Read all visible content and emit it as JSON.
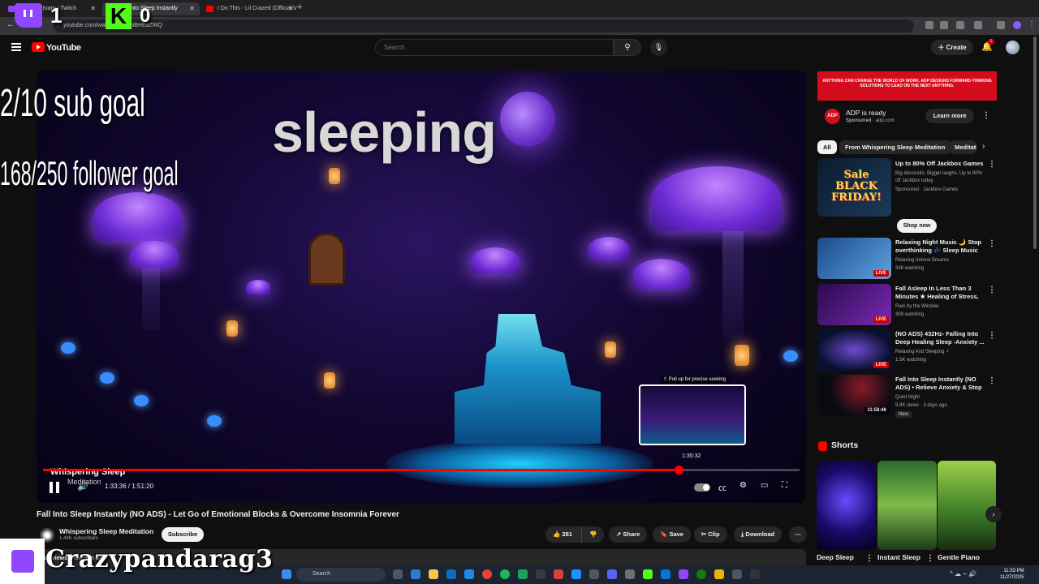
{
  "browser": {
    "tabs": [
      {
        "label": "voyager_tuary - Twitch",
        "color": "#9146ff",
        "active": false
      },
      {
        "label": "Fall Into Sleep Instantly",
        "color": "#ff0000",
        "active": true
      },
      {
        "label": "I Do This - Lil Crazed (Official V",
        "color": "#ff0000",
        "active": false
      }
    ],
    "url": "youtube.com/watch?v=MBNBHEaZWQ"
  },
  "header": {
    "logo_text": "YouTube",
    "search_placeholder": "Search",
    "create_label": "Create",
    "notif_count": "1"
  },
  "player": {
    "overlay_word": "sleeping",
    "seek_hint": "Pull up for precise seeking",
    "seek_time": "1:35:32",
    "time_label": "1:33:36 / 1:51:20",
    "progress_fraction": 0.84,
    "watermark_line1": "Whispering Sleep",
    "watermark_line2": "Meditation"
  },
  "video": {
    "title": "Fall Into Sleep Instantly (NO ADS) - Let Go of Emotional Blocks & Overcome Insomnia Forever",
    "channel": "Whispering Sleep Meditation",
    "subscribers": "1.44K subscribers",
    "subscribe_label": "Subscribe",
    "likes": "281",
    "share_label": "Share",
    "save_label": "Save",
    "clip_label": "Clip",
    "download_label": "Download",
    "description_preview": "1K views  5 months ago"
  },
  "ad": {
    "banner_text": "ANYTHING CAN CHANGE THE WORLD OF WORK. ADP DESIGNS FORWARD-THINKING SOLUTIONS TO LEAD ON THE NEXT ANYTHING.",
    "logo": "ADP",
    "title": "ADP is ready",
    "sponsor": "Sponsored",
    "domain": "adp.com",
    "cta": "Learn more"
  },
  "chips": [
    "All",
    "From Whispering Sleep Meditation",
    "Meditation"
  ],
  "related": [
    {
      "title": "Up to 80% Off Jackbox Games",
      "meta1": "Big discounts. Bigger laughs. Up to 80% off Jackbox today.",
      "meta2": "Sponsored · Jackbox Games",
      "cta": "Shop now",
      "thumb_text": "Sale BLACK FRIDAY!"
    },
    {
      "title": "Relaxing Night Music 🌙 Stop overthinking 💤 Sleep Music f...",
      "meta1": "Relaxing Animal Dreams",
      "meta2": "336 watching",
      "badge": "LIVE"
    },
    {
      "title": "Fall Asleep In Less Than 3 Minutes ★ Healing of Stress, ...",
      "meta1": "Rain by the Window",
      "meta2": "309 watching",
      "badge": "LIVE"
    },
    {
      "title": "(NO ADS) 432Hz- Falling Into Deep Healing Sleep -Anxiety ...",
      "meta1": "Relaxing And Sleeping ✓",
      "meta2": "1.5K watching",
      "badge": "LIVE"
    },
    {
      "title": "Fall Into Sleep Instantly (NO ADS) • Relieve Anxiety & Stop ...",
      "meta1": "Quiet Night",
      "meta2": "9.8K views · 3 days ago",
      "badge": "11:58:46",
      "new": "New"
    }
  ],
  "shorts": {
    "heading": "Shorts",
    "items": [
      {
        "title": "Deep Sleep"
      },
      {
        "title": "Instant Sleep"
      },
      {
        "title": "Gentle Piano"
      }
    ]
  },
  "stream_overlay": {
    "sub_goal": "2/10 sub goal",
    "follower_goal": "168/250 follower goal",
    "twitch_count": "1",
    "kick_letter": "K",
    "kick_count": "0",
    "handle": "Crazypandarag3"
  },
  "taskbar": {
    "search_label": "Search",
    "time": "11:33 PM",
    "date": "11/27/2025"
  },
  "colors": {
    "accent": "#ff0000",
    "twitch": "#9146ff",
    "kick": "#53fc18",
    "adp": "#d40d1d"
  }
}
